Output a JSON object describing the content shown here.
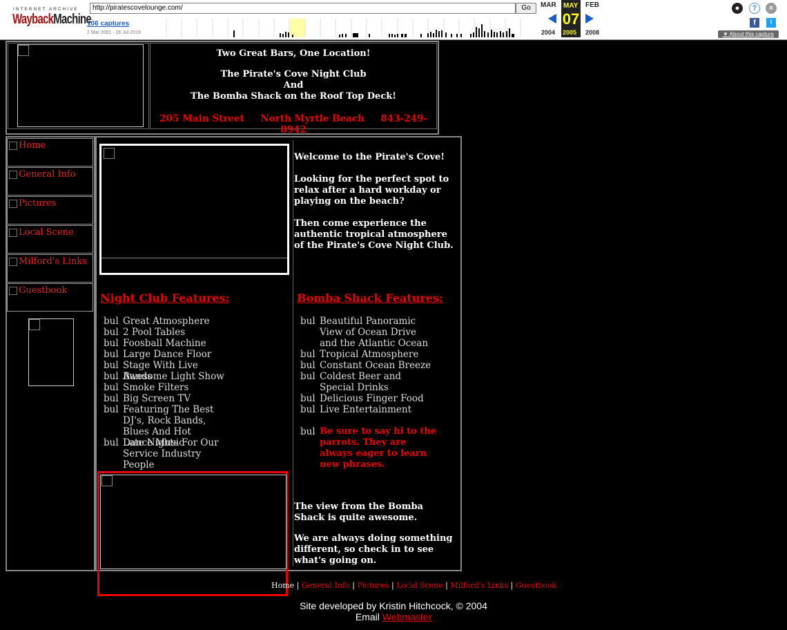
{
  "wayback": {
    "ia_label": "INTERNET ARCHIVE",
    "logo_1": "Wayback",
    "logo_2": "Machine",
    "url": "http://piratescovelounge.com/",
    "go": "Go",
    "captures": "106 captures",
    "range": "2 Mar 2001 - 26 Jul 2019",
    "prev_month": "MAR",
    "cur_month": "MAY",
    "next_month": "FEB",
    "cur_day": "07",
    "prev_year": "2004",
    "cur_year": "2005",
    "next_year": "2008",
    "about": "About this capture"
  },
  "header": {
    "line1": "Two Great Bars, One Location!",
    "line2": "The Pirate's Cove Night Club",
    "line3": "And",
    "line4": "The Bomba Shack on the Roof Top Deck!",
    "address": "205 Main Street",
    "city": "North Myrtle Beach",
    "phone": "843-249-8942"
  },
  "nav": [
    "Home",
    "General Info",
    "Pictures",
    "Local Scene",
    "Milford's Links",
    "Guestbook"
  ],
  "welcome": {
    "title": "Welcome to the Pirate's Cove!",
    "p1": "Looking for the perfect spot to relax after a hard  workday or playing on the beach?",
    "p2": "Then come experience the authentic tropical atmosphere of the Pirate's Cove Night Club."
  },
  "nightclub": {
    "heading": "Night Club Features:",
    "bullet": "bul",
    "items": [
      "Great Atmosphere",
      "2 Pool Tables",
      "Foosball Machine",
      "Large Dance Floor",
      "Stage With Live Bands",
      "Awesome Light Show",
      "Smoke Filters",
      "Big Screen TV",
      "Featuring The Best DJ's, Rock Bands, Blues And Hot Dance Music",
      "Late Nights For Our Service Industry People"
    ]
  },
  "bomba": {
    "heading": "Bomba Shack Features:",
    "bullet": "bul",
    "items": [
      "Beautiful Panoramic View of Ocean Drive and the Atlantic Ocean",
      "Tropical Atmosphere",
      "Constant Ocean Breeze",
      "Coldest Beer and Special Drinks",
      "Delicious Finger Food",
      "Live Entertainment"
    ],
    "parrots": "Be sure to say hi to the parrots. They are always eager to learn new phrases."
  },
  "view": {
    "p1": "The view from the Bomba Shack is quite awesome.",
    "p2": "We are always doing something different, so check in to see what's going on."
  },
  "footer": {
    "links": [
      "Home",
      "General Info",
      "Pictures",
      "Local Scene",
      "Milford's Links",
      "Guestbook"
    ],
    "separator": "|",
    "credit": "Site developed by Kristin Hitchcock, © 2004",
    "email_label": "Email",
    "email_link": "Webmaster"
  }
}
